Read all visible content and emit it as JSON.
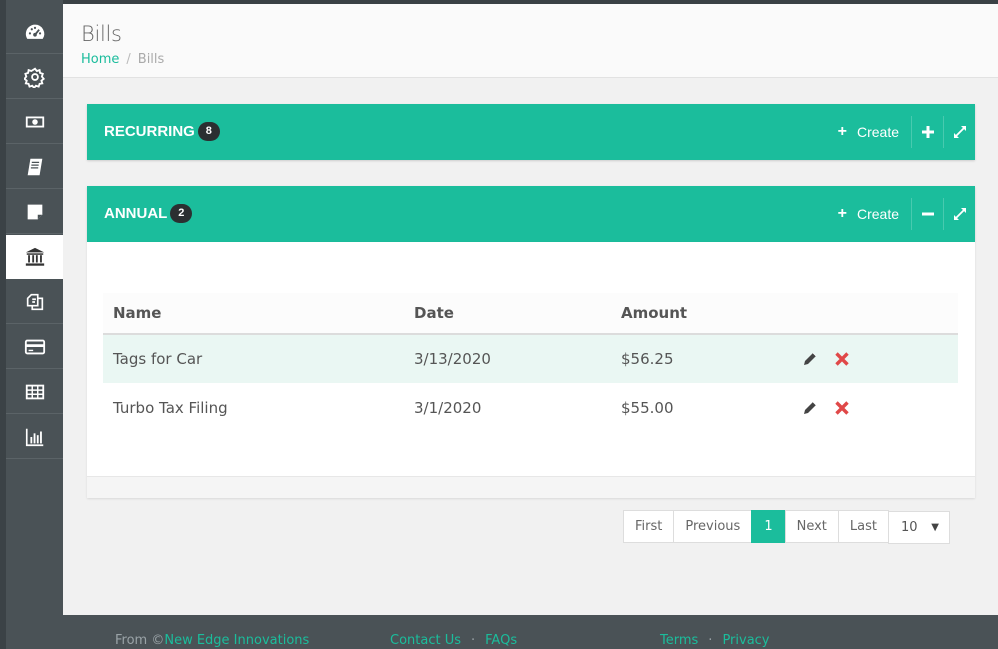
{
  "header": {
    "title": "Bills",
    "breadcrumb": {
      "home": "Home",
      "separator": "/",
      "current": "Bills"
    }
  },
  "sidebar": {
    "items": [
      {
        "icon": "dashboard-icon",
        "active": false
      },
      {
        "icon": "gear-icon",
        "active": false
      },
      {
        "icon": "money-icon",
        "active": false
      },
      {
        "icon": "book-icon",
        "active": false
      },
      {
        "icon": "note-icon",
        "active": false
      },
      {
        "icon": "bank-icon",
        "active": true
      },
      {
        "icon": "copy-icon",
        "active": false
      },
      {
        "icon": "credit-card-icon",
        "active": false
      },
      {
        "icon": "table-icon",
        "active": false
      },
      {
        "icon": "bar-chart-icon",
        "active": false
      }
    ]
  },
  "panels": {
    "recurring": {
      "title": "RECURRING",
      "count": "8",
      "create_label": "Create",
      "toggle": "expand"
    },
    "annual": {
      "title": "ANNUAL",
      "count": "2",
      "create_label": "Create",
      "toggle": "collapse"
    }
  },
  "table": {
    "columns": [
      "Name",
      "Date",
      "Amount"
    ],
    "rows": [
      {
        "name": "Tags for Car",
        "date": "3/13/2020",
        "amount": "$56.25"
      },
      {
        "name": "Turbo Tax Filing",
        "date": "3/1/2020",
        "amount": "$55.00"
      }
    ]
  },
  "pagination": {
    "first": "First",
    "previous": "Previous",
    "current": "1",
    "next": "Next",
    "last": "Last",
    "page_size": "10"
  },
  "footer": {
    "from_prefix": "From ©",
    "company": "New Edge Innovations",
    "contact": "Contact Us",
    "dot": "·",
    "faqs": "FAQs",
    "terms": "Terms",
    "privacy": "Privacy"
  },
  "colors": {
    "accent": "#1bbd9c",
    "sidebar": "#4a5256",
    "delete": "#e04848",
    "badge": "#2b2f31"
  }
}
